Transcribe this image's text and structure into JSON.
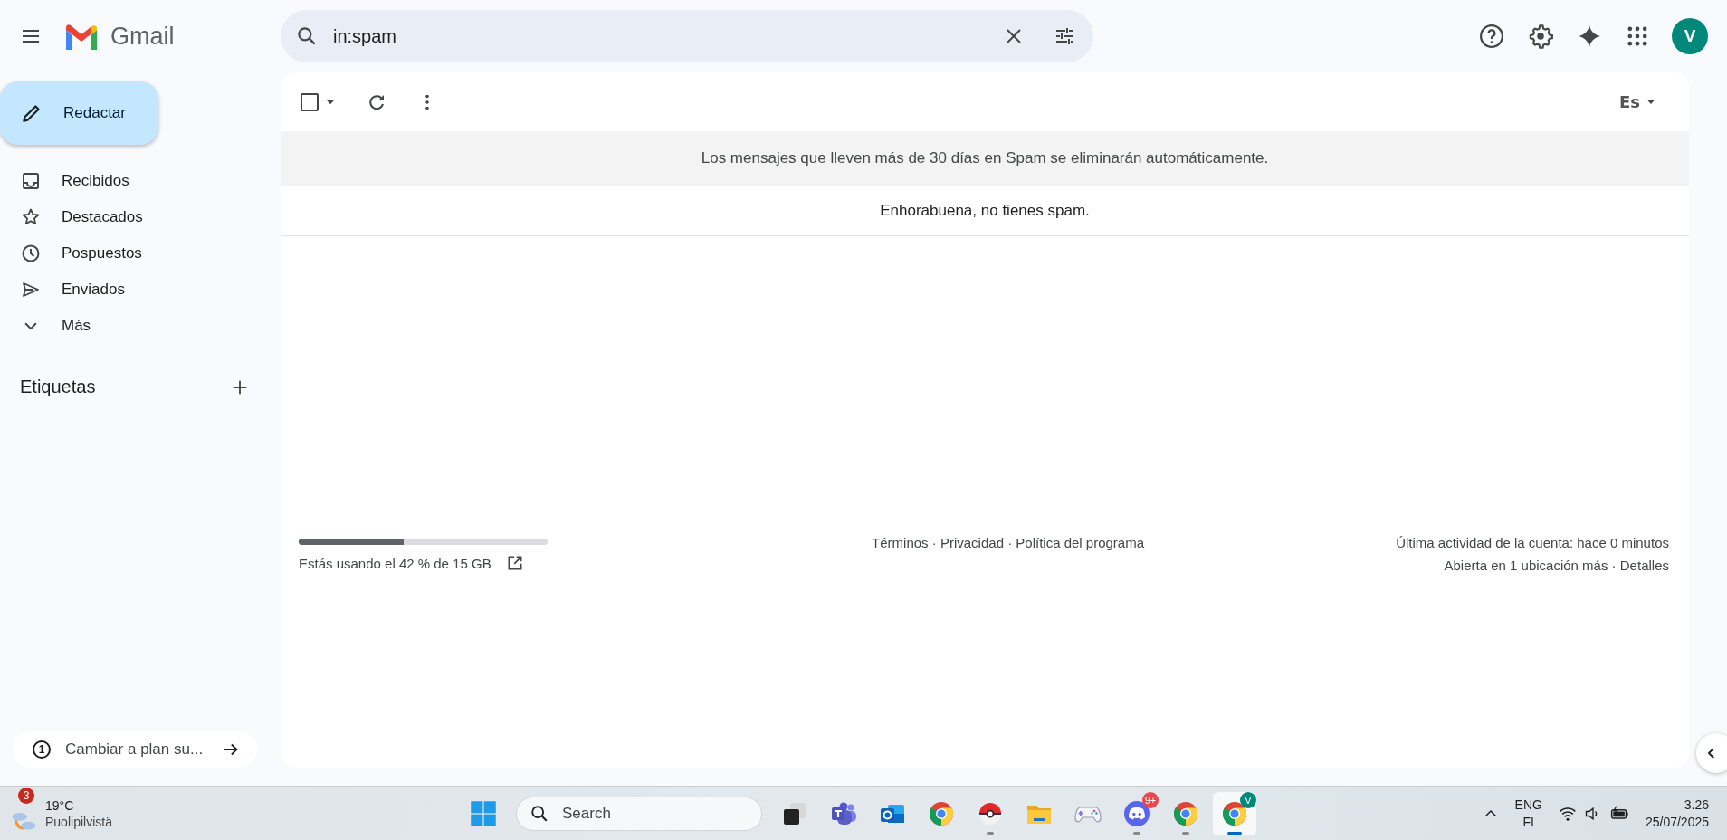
{
  "header": {
    "app_name": "Gmail",
    "search": {
      "value": "in:spam"
    },
    "avatar": "V"
  },
  "sidebar": {
    "compose": "Redactar",
    "items": [
      {
        "label": "Recibidos",
        "selected": false
      },
      {
        "label": "Destacados",
        "selected": false
      },
      {
        "label": "Pospuestos",
        "selected": false
      },
      {
        "label": "Enviados",
        "selected": false
      },
      {
        "label": "Más",
        "selected": false
      }
    ],
    "labels_heading": "Etiquetas",
    "upgrade": {
      "badge": "1",
      "label": "Cambiar a plan su..."
    }
  },
  "toolbar": {
    "select_all": {
      "checked": false
    },
    "input_tools": "Es"
  },
  "notice": "Los mensajes que lleven más de 30 días en Spam se eliminarán automáticamente.",
  "empty_message": "Enhorabuena, no tienes spam.",
  "footer": {
    "storage": {
      "level": 0.42,
      "text": "Estás usando el 42 % de 15 GB"
    },
    "links": "Términos · Privacidad · Política del programa",
    "activity": "Última actividad de la cuenta: hace 0 minutos",
    "details": "Abierta en 1 ubicación más · Detalles"
  },
  "taskbar": {
    "weather": {
      "badge": "3",
      "temp": "19°C",
      "condition": "Puolipilvistä"
    },
    "search": {
      "placeholder": "Search"
    },
    "apps": [
      {
        "kind": "taskview",
        "running": false,
        "selected": false
      },
      {
        "kind": "teams",
        "running": false,
        "selected": false
      },
      {
        "kind": "outlook",
        "running": false,
        "selected": false
      },
      {
        "kind": "chrome",
        "running": false,
        "selected": false
      },
      {
        "kind": "pokeball",
        "running": true,
        "selected": false
      },
      {
        "kind": "folder",
        "running": false,
        "selected": false
      },
      {
        "kind": "gamepad",
        "running": false,
        "selected": false
      },
      {
        "kind": "discord",
        "running": true,
        "selected": false,
        "badge": "9+"
      },
      {
        "kind": "chrome",
        "running": true,
        "selected": false
      },
      {
        "kind": "chrome",
        "running": true,
        "selected": true,
        "badge": "V"
      }
    ],
    "language": "ENG",
    "layout": "FI",
    "time": "3.26",
    "date": "25/07/2025"
  }
}
